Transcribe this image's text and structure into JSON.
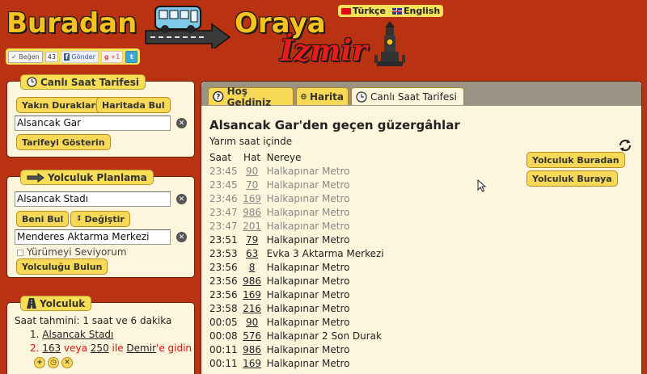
{
  "header": {
    "logo_left": "Buradan",
    "logo_right": "Oraya",
    "city": "İzmir",
    "languages": [
      {
        "label": "Türkçe",
        "flag": "tr-flag"
      },
      {
        "label": "English",
        "flag": "en-flag"
      }
    ],
    "social": {
      "like": "Beğen",
      "like_count": "43",
      "fb_send": "Gönder",
      "gplus": "+1",
      "twitter": "t"
    }
  },
  "live_panel": {
    "title": "Canlı Saat Tarifesi",
    "nearby_button": "Yakın Durakları",
    "map_button": "Haritada Bul",
    "stop_input": "Alsancak Gar",
    "show_button": "Tarifeyi Gösterin"
  },
  "plan_panel": {
    "title": "Yolculuk Planlama",
    "from_input": "Alsancak Stadı",
    "find_me_button": "Beni Bul",
    "swap_button": "Değiştir",
    "to_input": "Menderes Aktarma Merkezi",
    "walk_label": "Yürümeyi Seviyorum",
    "find_button": "Yolculuğu Bulun"
  },
  "route_panel": {
    "title": "Yolculuk",
    "summary": "Saat tahmini: 1 saat ve 6 dakika",
    "step1_num": "1.",
    "step1_text": "Alsancak Stadı",
    "step2_num": "2.",
    "step2_line1": "163",
    "step2_or": "veya",
    "step2_line2": "250",
    "step2_with": "ile",
    "step2_dest": "Demir",
    "step2_suffix": "'e gidin"
  },
  "main": {
    "tabs": [
      {
        "label": "Hoş Geldiniz",
        "icon": "help-icon"
      },
      {
        "label": "Harita",
        "icon": "globe-icon"
      },
      {
        "label": "Canlı Saat Tarifesi",
        "icon": "clock-icon"
      }
    ],
    "heading": "Alsancak Gar'den geçen güzergâhlar",
    "subtitle": "Yarım saat içinde",
    "columns": [
      "Saat",
      "Hat",
      "Nereye"
    ],
    "rows": [
      {
        "time": "23:45",
        "line": "90",
        "dest": "Halkapınar Metro",
        "past": true
      },
      {
        "time": "23:45",
        "line": "70",
        "dest": "Halkapınar Metro",
        "past": true
      },
      {
        "time": "23:46",
        "line": "169",
        "dest": "Halkapınar Metro",
        "past": true
      },
      {
        "time": "23:47",
        "line": "986",
        "dest": "Halkapınar Metro",
        "past": true
      },
      {
        "time": "23:47",
        "line": "201",
        "dest": "Halkapınar Metro",
        "past": true
      },
      {
        "time": "23:51",
        "line": "79",
        "dest": "Halkapınar Metro",
        "past": false
      },
      {
        "time": "23:53",
        "line": "63",
        "dest": "Evka 3 Aktarma Merkezi",
        "past": false
      },
      {
        "time": "23:56",
        "line": "8",
        "dest": "Halkapınar Metro",
        "past": false
      },
      {
        "time": "23:56",
        "line": "986",
        "dest": "Halkapınar Metro",
        "past": false
      },
      {
        "time": "23:56",
        "line": "169",
        "dest": "Halkapınar Metro",
        "past": false
      },
      {
        "time": "23:58",
        "line": "216",
        "dest": "Halkapınar Metro",
        "past": false
      },
      {
        "time": "00:05",
        "line": "90",
        "dest": "Halkapınar Metro",
        "past": false
      },
      {
        "time": "00:08",
        "line": "576",
        "dest": "Halkapınar 2 Son Durak",
        "past": false
      },
      {
        "time": "00:11",
        "line": "986",
        "dest": "Halkapınar Metro",
        "past": false
      },
      {
        "time": "00:11",
        "line": "169",
        "dest": "Halkapınar Metro",
        "past": false
      }
    ],
    "trip_from_button": "Yolculuk Buradan",
    "trip_to_button": "Yolculuk Buraya"
  }
}
